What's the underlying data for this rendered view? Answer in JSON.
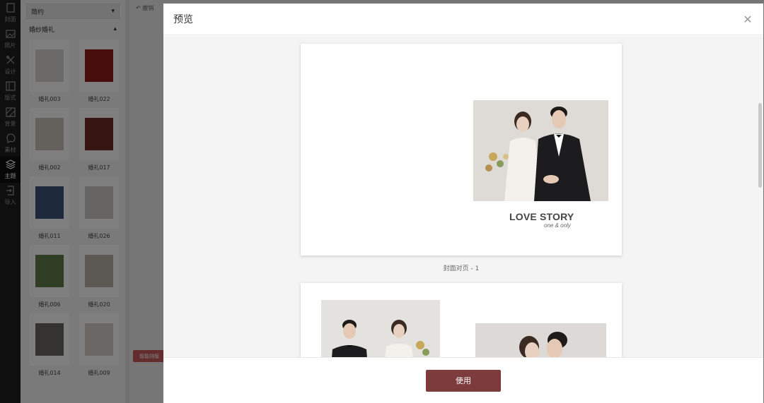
{
  "toolbar": {
    "items": [
      {
        "label": "封面",
        "icon": "cover-icon"
      },
      {
        "label": "照片",
        "icon": "photo-icon"
      },
      {
        "label": "设计",
        "icon": "design-icon"
      },
      {
        "label": "版式",
        "icon": "layout-icon"
      },
      {
        "label": "背景",
        "icon": "background-icon"
      },
      {
        "label": "素材",
        "icon": "material-icon"
      },
      {
        "label": "主题",
        "icon": "theme-icon"
      },
      {
        "label": "导入",
        "icon": "import-icon"
      }
    ],
    "active_index": 6
  },
  "panel": {
    "style_select": "简约",
    "category": "婚纱婚礼",
    "templates": [
      {
        "label": "婚礼003",
        "tone": "#d8d4d0"
      },
      {
        "label": "婚礼022",
        "tone": "#8e1c17"
      },
      {
        "label": "婚礼002",
        "tone": "#c9c2b8"
      },
      {
        "label": "婚礼017",
        "tone": "#6e2a22"
      },
      {
        "label": "婚礼011",
        "tone": "#3d5077"
      },
      {
        "label": "婚礼026",
        "tone": "#cfcac6"
      },
      {
        "label": "婚礼006",
        "tone": "#5d7a46"
      },
      {
        "label": "婚礼020",
        "tone": "#b9b2ab"
      },
      {
        "label": "婚礼014",
        "tone": "#6b6760"
      },
      {
        "label": "婚礼009",
        "tone": "#d6cfc8"
      }
    ]
  },
  "workspace": {
    "undo_label": "撤销",
    "smart_button": "智能排版"
  },
  "modal": {
    "title": "预览",
    "pages": [
      {
        "caption": "封面对页 - 1",
        "headline": "LOVE STORY",
        "subline": "one & only"
      }
    ],
    "use_button": "使用"
  },
  "colors": {
    "accent": "#7d3b3d",
    "sidebar_bg": "#1f1f1f",
    "smart_button": "#c95a5a"
  }
}
